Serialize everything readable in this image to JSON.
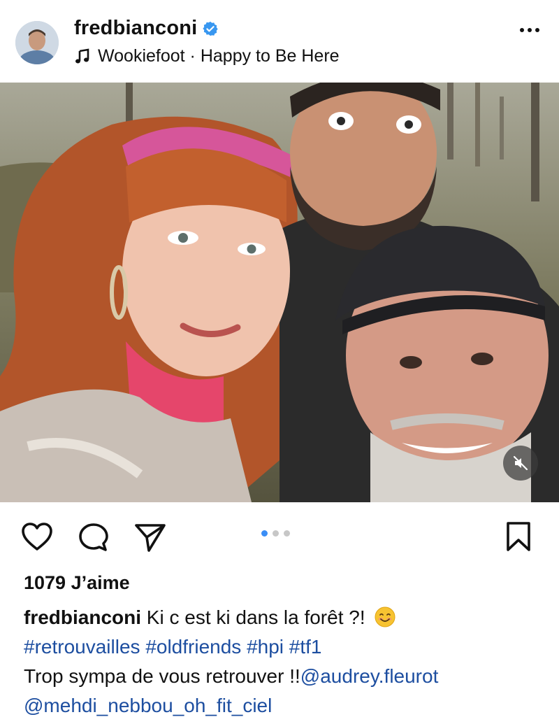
{
  "post": {
    "username": "fredbianconi",
    "audio_track": "Wookiefoot · Happy to Be Here",
    "more_icon": "more-horizontal-icon",
    "carousel": {
      "count": 3,
      "active_index": 0
    },
    "likes_text": "1079 J’aime",
    "caption": {
      "username": "fredbianconi",
      "text": "Ki c est ki dans la forêt ?!",
      "emoji": "smiling-face-emoji",
      "hashtags": [
        "#retrouvailles",
        "#oldfriends",
        "#hpi",
        "#tf1"
      ],
      "line3_text": "Trop sympa de vous retrouver !!",
      "mention1": "@audrey.fleurot",
      "mention2": "@mehdi_nebbou_oh_fit_ciel"
    }
  },
  "colors": {
    "verified": "#3897f0",
    "hashtag": "#1d4ea0",
    "carousel_active": "#3a8ef6",
    "carousel_inactive": "#c7c7c7"
  },
  "icons": [
    "heart-icon",
    "comment-icon",
    "share-icon",
    "bookmark-icon",
    "mute-icon",
    "music-note-icon",
    "verified-badge-icon"
  ]
}
